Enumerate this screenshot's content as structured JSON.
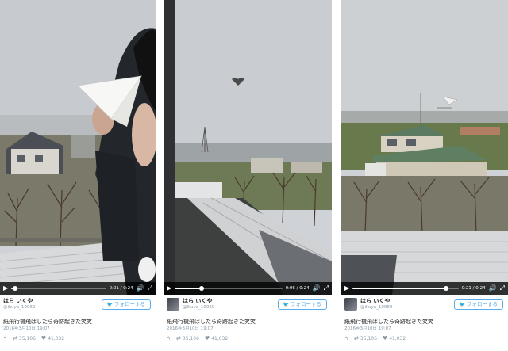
{
  "panels": [
    {
      "player": {
        "time": "0:01 / 0:24",
        "progress": 0.04
      },
      "tweet": {
        "display_name": "はら いくや",
        "handle": "@ikuya_10969",
        "follow_label": "フォローする",
        "text": "紙飛行機飛ばしたら奇跡起きた笑笑",
        "date": "2016年3月10日 19:07",
        "retweets": "35,106",
        "likes": "41,032"
      }
    },
    {
      "player": {
        "time": "0:06 / 0:24",
        "progress": 0.25
      },
      "tweet": {
        "display_name": "はら いくや",
        "handle": "@ikuya_10969",
        "follow_label": "フォローする",
        "text": "紙飛行機飛ばしたら奇跡起きた笑笑",
        "date": "2016年3月10日 19:07",
        "retweets": "35,106",
        "likes": "41,032"
      }
    },
    {
      "player": {
        "time": "0:21 / 0:24",
        "progress": 0.88
      },
      "tweet": {
        "display_name": "はら いくや",
        "handle": "@ikuya_10969",
        "follow_label": "フォローする",
        "text": "紙飛行機飛ばしたら奇跡起きた笑笑",
        "date": "2016年3月10日 19:07",
        "retweets": "35,106",
        "likes": "41,032"
      }
    }
  ],
  "icons": {
    "play": "▶",
    "volume": "🔊",
    "fullscreen": "⤢",
    "follow_bird": "🐦",
    "reply": "↰",
    "retweet": "⇄",
    "like": "♥"
  },
  "colors": {
    "twitter_blue": "#55acee",
    "muted": "#8899a6",
    "controls_bg": "#000000"
  }
}
